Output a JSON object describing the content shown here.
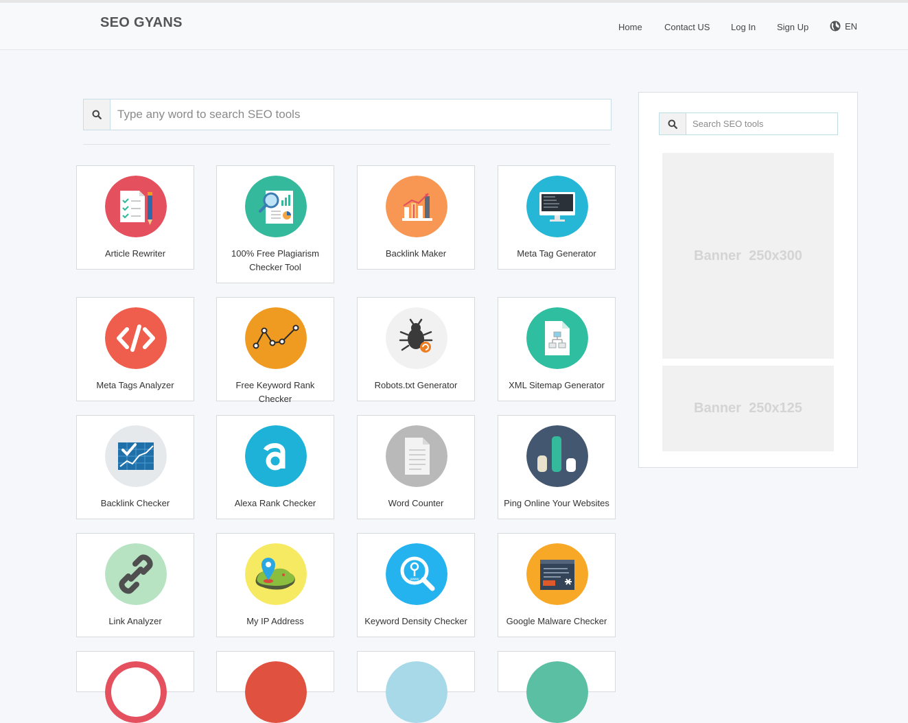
{
  "header": {
    "brand": "SEO GYANS",
    "nav": [
      {
        "label": "Home",
        "name": "nav-home"
      },
      {
        "label": "Contact US",
        "name": "nav-contact-us"
      },
      {
        "label": "Log In",
        "name": "nav-log-in"
      },
      {
        "label": "Sign Up",
        "name": "nav-sign-up"
      }
    ],
    "language": {
      "label": "EN",
      "icon": "globe-icon"
    }
  },
  "search": {
    "placeholder": "Type any word to search SEO tools",
    "icon": "search-icon"
  },
  "tools": [
    {
      "label": "Article Rewriter",
      "icon": "checklist-pencil-icon",
      "color": "#e5505e"
    },
    {
      "label": "100% Free Plagiarism Checker Tool",
      "icon": "magnifier-report-icon",
      "color": "#35b99d"
    },
    {
      "label": "Backlink Maker",
      "icon": "bar-growth-icon",
      "color": "#f79753"
    },
    {
      "label": "Meta Tag Generator",
      "icon": "monitor-code-icon",
      "color": "#26b6d6"
    },
    {
      "label": "Meta Tags Analyzer",
      "icon": "code-brackets-icon",
      "color": "#ef5d4c"
    },
    {
      "label": "Free Keyword Rank Checker",
      "icon": "line-graph-icon",
      "color": "#ef9b22"
    },
    {
      "label": "Robots.txt Generator",
      "icon": "bug-icon",
      "color": "#f1f1f1"
    },
    {
      "label": "XML Sitemap Generator",
      "icon": "sitemap-file-icon",
      "color": "#2fbfa0"
    },
    {
      "label": "Backlink Checker",
      "icon": "chart-check-icon",
      "color": "#e6e9ec"
    },
    {
      "label": "Alexa Rank Checker",
      "icon": "alexa-a-icon",
      "color": "#1eb2d8"
    },
    {
      "label": "Word Counter",
      "icon": "document-icon",
      "color": "#b9b9b9"
    },
    {
      "label": "Ping Online Your Websites",
      "icon": "bars-icon",
      "color": "#435870"
    },
    {
      "label": "Link Analyzer",
      "icon": "chain-link-icon",
      "color": "#b7e3c3"
    },
    {
      "label": "My IP Address",
      "icon": "map-pin-icon",
      "color": "#f7ea63"
    },
    {
      "label": "Keyword Density Checker",
      "icon": "magnifier-www-icon",
      "color": "#25b3f0"
    },
    {
      "label": "Google Malware Checker",
      "icon": "browser-malware-icon",
      "color": "#f7a826"
    }
  ],
  "partial_row_colors": [
    "#e5505e",
    "#e0513f",
    "#a8d9e8",
    "#5bbfa4"
  ],
  "sidebar": {
    "search_placeholder": "Search SEO tools",
    "banner_large": "Banner  250x300",
    "banner_small": "Banner  250x125"
  }
}
